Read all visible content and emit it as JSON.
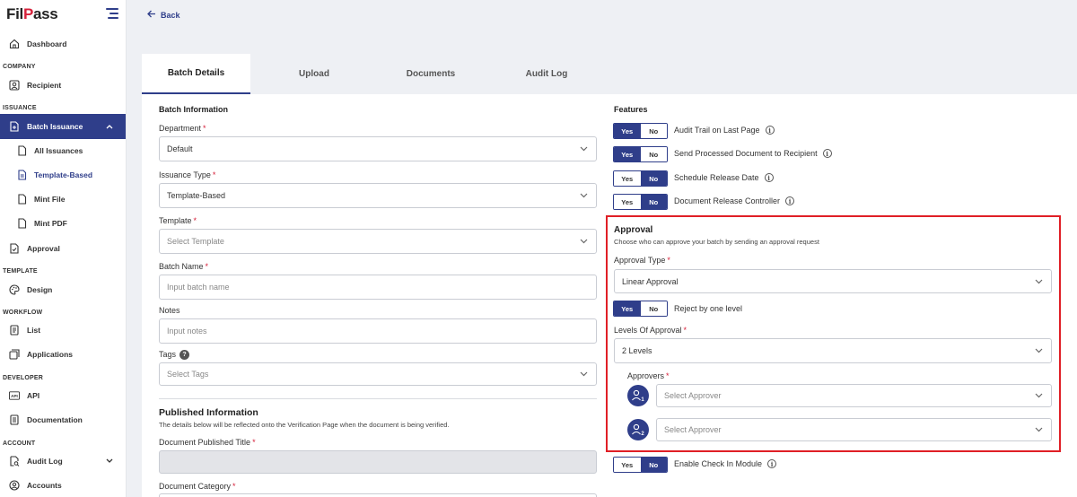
{
  "brand": {
    "name_part1": "Fil",
    "name_accent": "P",
    "name_part2": "ass"
  },
  "sidebar": {
    "dashboard": "Dashboard",
    "sections": {
      "company": "COMPANY",
      "issuance": "ISSUANCE",
      "template": "TEMPLATE",
      "workflow": "WORKFLOW",
      "developer": "DEVELOPER",
      "account": "ACCOUNT"
    },
    "recipient": "Recipient",
    "batch_issuance": "Batch Issuance",
    "all_issuances": "All Issuances",
    "template_based": "Template-Based",
    "mint_file": "Mint File",
    "mint_pdf": "Mint PDF",
    "approval": "Approval",
    "design": "Design",
    "list": "List",
    "applications": "Applications",
    "api": "API",
    "documentation": "Documentation",
    "audit_log": "Audit Log",
    "accounts": "Accounts"
  },
  "back_label": "Back",
  "tabs": [
    "Batch Details",
    "Upload",
    "Documents",
    "Audit Log"
  ],
  "batch": {
    "section_title": "Batch Information",
    "department_label": "Department",
    "department_value": "Default",
    "issuance_type_label": "Issuance Type",
    "issuance_type_value": "Template-Based",
    "template_label": "Template",
    "template_placeholder": "Select Template",
    "batch_name_label": "Batch Name",
    "batch_name_placeholder": "Input batch name",
    "notes_label": "Notes",
    "notes_placeholder": "Input notes",
    "tags_label": "Tags",
    "tags_placeholder": "Select Tags",
    "help_glyph": "?",
    "required_mark": "*"
  },
  "published": {
    "title": "Published Information",
    "description": "The details below will be reflected onto the Verification Page when the document is being verified.",
    "doc_title_label": "Document Published Title",
    "doc_category_label": "Document Category"
  },
  "features": {
    "title": "Features",
    "yes": "Yes",
    "no": "No",
    "info_glyph": "i",
    "items": [
      {
        "label": "Audit Trail on Last Page",
        "selected": "Yes"
      },
      {
        "label": "Send Processed Document to Recipient",
        "selected": "Yes"
      },
      {
        "label": "Schedule Release Date",
        "selected": "No"
      },
      {
        "label": "Document Release Controller",
        "selected": "No"
      }
    ]
  },
  "approval": {
    "title": "Approval",
    "description": "Choose who can approve your batch by sending an approval request",
    "type_label": "Approval Type",
    "type_value": "Linear Approval",
    "reject_label": "Reject by one level",
    "reject_selected": "Yes",
    "levels_label": "Levels Of Approval",
    "levels_value": "2 Levels",
    "approvers_label": "Approvers",
    "approver_placeholder": "Select Approver",
    "approver_indices": [
      "1",
      "2"
    ]
  },
  "check_in": {
    "label": "Enable Check In Module",
    "selected": "No"
  },
  "colors": {
    "primary": "#2f3e8a",
    "highlight": "#e01f26",
    "required": "#d6203a"
  }
}
